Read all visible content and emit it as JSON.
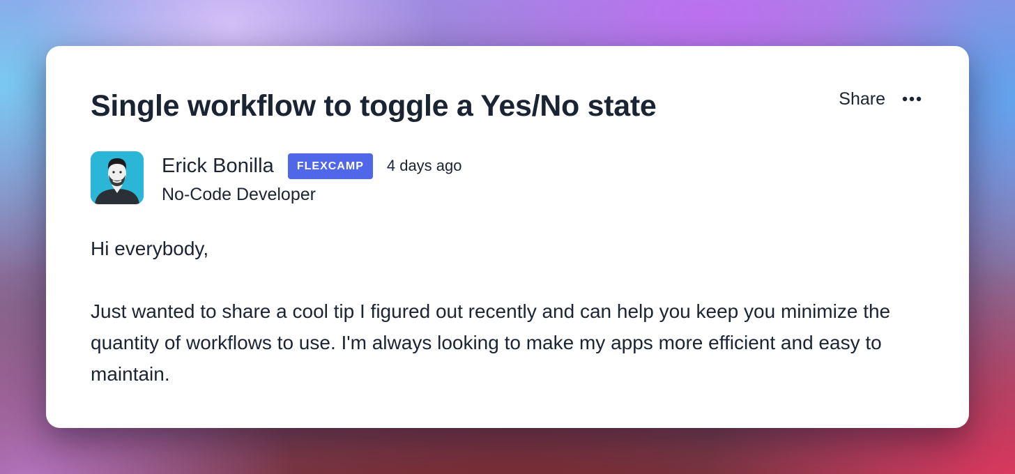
{
  "post": {
    "title": "Single workflow to toggle a Yes/No state",
    "share_label": "Share",
    "more_icon": "more-horizontal-icon"
  },
  "author": {
    "name": "Erick Bonilla",
    "badge": "FLEXCAMP",
    "posted": "4 days ago",
    "role": "No-Code Developer",
    "avatar_icon": "avatar"
  },
  "content": {
    "greeting": "Hi everybody,",
    "paragraph": "Just wanted to share a cool tip I figured out recently and can help you keep you minimize the quantity of workflows to use. I'm always looking to make my apps more efficient and easy to maintain."
  },
  "colors": {
    "text": "#1a2433",
    "badge_bg": "#4f67e8",
    "avatar_bg": "#2bb6d8",
    "card_bg": "#ffffff"
  }
}
